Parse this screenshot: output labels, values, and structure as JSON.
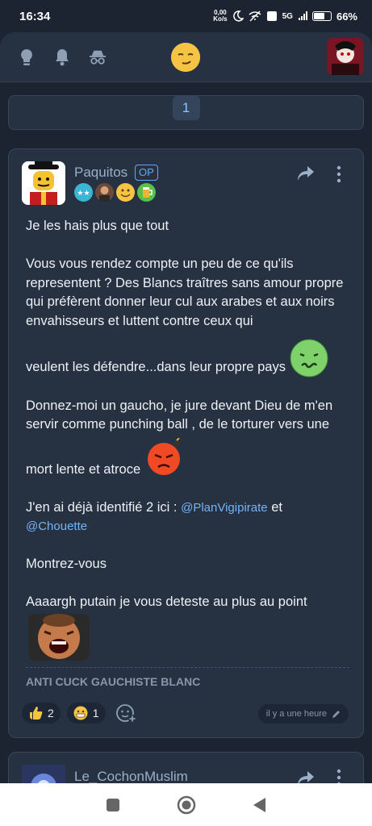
{
  "status": {
    "time": "16:34",
    "net_speed_value": "0,00",
    "net_speed_unit": "Ko/s",
    "signal": "5G",
    "battery": "66%",
    "battery_level": 0.66
  },
  "topbar": {
    "icons": [
      "lightbulb-icon",
      "bell-icon",
      "incognito-icon"
    ],
    "center_emoji": "smirk-emoji"
  },
  "pager": {
    "current_page": "1"
  },
  "post": {
    "username": "Paquitos",
    "op_label": "OP",
    "badges": [
      "stars-badge",
      "avatar-badge",
      "smile-badge",
      "beer-badge"
    ],
    "paragraphs": [
      "Je les hais plus que tout",
      "Vous vous rendez compte un peu de ce qu'ils representent ? Des Blancs traîtres sans amour propre qui préfèrent donner leur cul aux arabes et aux noirs envahisseurs et luttent contre ceux qui",
      "veulent les défendre...dans leur propre pays",
      "Donnez-moi un gaucho, je jure devant Dieu de m'en servir comme punching ball , de le torturer vers une",
      "mort lente et atroce",
      "J'en ai déjà identifié 2 ici :",
      "et",
      "Montrez-vous",
      "Aaaargh putain je vous deteste au plus au point"
    ],
    "mentions": [
      "@PlanVigipirate",
      "@Chouette"
    ],
    "signature": "ANTI CUCK GAUCHISTE BLANC",
    "reactions": [
      {
        "emoji": "thumbs-up-emoji",
        "count": "2"
      },
      {
        "emoji": "grimace-emoji",
        "count": "1"
      }
    ],
    "timestamp": "il y a une heure"
  },
  "next_post": {
    "username": "Le_CochonMuslim"
  },
  "colors": {
    "background": "#1c2331",
    "card": "#263142",
    "accent": "#5fa8f5",
    "mention": "#74b4f7"
  }
}
